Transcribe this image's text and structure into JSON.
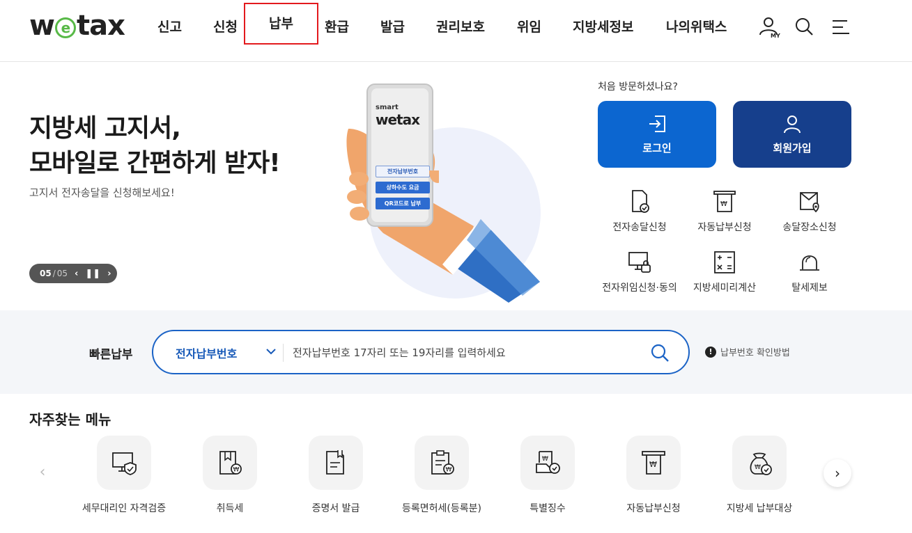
{
  "header": {
    "logo_text_w": "w",
    "logo_text_e": "e",
    "logo_text_tax": "tax",
    "nav": [
      "신고",
      "신청",
      "납부",
      "환급",
      "발급",
      "권리보호",
      "위임",
      "지방세정보",
      "나의위택스"
    ],
    "active_nav": "납부",
    "my_label": "MY",
    "icons": [
      "my-user-icon",
      "search-icon",
      "menu-icon"
    ]
  },
  "hero": {
    "title_line1": "지방세 고지서,",
    "title_line2": "모바일로 간편하게 받자!",
    "subtitle": "고지서 전자송달을 신청해보세요!",
    "slider": {
      "current": "05",
      "separator": "/",
      "total": "05"
    },
    "phone": {
      "smart": "smart",
      "logo": "wetax",
      "buttons": [
        "전자납부번호",
        "상하수도 요금",
        "QR코드로 납부"
      ]
    }
  },
  "member": {
    "question": "처음 방문하셨나요?",
    "login": "로그인",
    "join": "회원가입"
  },
  "quick_links": [
    {
      "label": "전자송달신청",
      "icon": "document-check-icon"
    },
    {
      "label": "자동납부신청",
      "icon": "auto-pay-icon"
    },
    {
      "label": "송달장소신청",
      "icon": "location-mail-icon"
    },
    {
      "label": "전자위임신청·동의",
      "icon": "monitor-lock-icon"
    },
    {
      "label": "지방세미리계산",
      "icon": "calculator-icon"
    },
    {
      "label": "탈세제보",
      "icon": "siren-icon"
    }
  ],
  "fast_pay": {
    "label": "빠른납부",
    "select_value": "전자납부번호",
    "placeholder": "전자납부번호 17자리 또는 19자리를 입력하세요",
    "help": "납부번호 확인방법",
    "help_badge": "!"
  },
  "frequent": {
    "title": "자주찾는 메뉴",
    "items": [
      {
        "label": "세무대리인 자격검증",
        "icon": "monitor-shield-icon"
      },
      {
        "label": "취득세",
        "icon": "acquisition-tax-icon"
      },
      {
        "label": "증명서 발급",
        "icon": "certificate-icon"
      },
      {
        "label": "등록면허세(등록분)",
        "icon": "registration-tax-icon"
      },
      {
        "label": "특별징수",
        "icon": "special-collection-icon"
      },
      {
        "label": "자동납부신청",
        "icon": "auto-pay-icon"
      },
      {
        "label": "지방세 납부대상",
        "icon": "money-bag-icon"
      }
    ],
    "prev": "‹",
    "next": "›"
  }
}
